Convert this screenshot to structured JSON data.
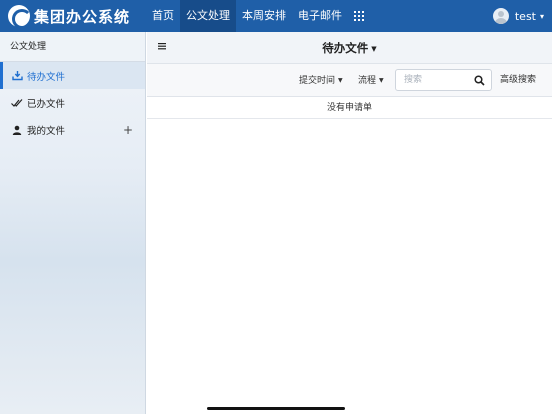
{
  "app": {
    "title": "集团办公系统"
  },
  "nav": {
    "items": [
      {
        "label": "首页",
        "active": false
      },
      {
        "label": "公文处理",
        "active": true
      },
      {
        "label": "本周安排",
        "active": false
      },
      {
        "label": "电子邮件",
        "active": false
      }
    ],
    "apps_icon": "grid-icon"
  },
  "user": {
    "name": "test"
  },
  "sidebar": {
    "header": "公文处理",
    "items": [
      {
        "label": "待办文件",
        "icon": "inbox-download-icon",
        "active": true
      },
      {
        "label": "已办文件",
        "icon": "double-check-icon",
        "active": false
      },
      {
        "label": "我的文件",
        "icon": "person-icon",
        "active": false,
        "add": "+"
      }
    ]
  },
  "main": {
    "title": "待办文件",
    "toolbar": {
      "sort_label": "提交时间",
      "flow_label": "流程",
      "search_placeholder": "搜索",
      "advanced_search": "高级搜索"
    },
    "empty_text": "没有申请单"
  },
  "colors": {
    "topbar": "#1f5fa8",
    "accent": "#1f6fd0"
  }
}
